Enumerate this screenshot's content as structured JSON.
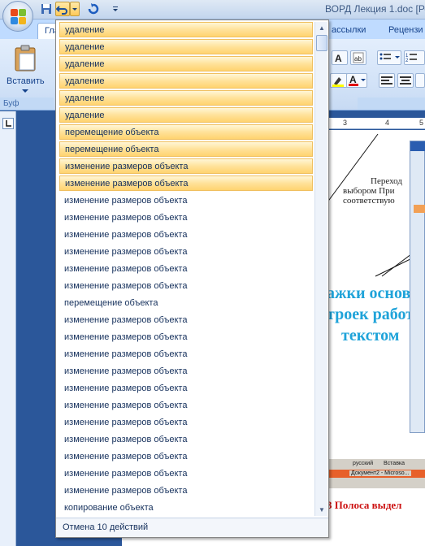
{
  "window": {
    "title": "ВОРД Лекция 1.doc [Реж"
  },
  "ribbon": {
    "tabs_visible": [
      "Гла",
      "ассылки",
      "Рецензи"
    ],
    "paste_label": "Вставить",
    "clipboard_group": "Буф"
  },
  "document": {
    "ruler_numbers": [
      "3",
      "4",
      "5"
    ],
    "text_small_1": "Переход",
    "text_small_2": "выбором При",
    "text_small_3": "соответствую",
    "text_big_1": "ажки основ",
    "text_big_2": "троек работ",
    "text_big_3": "текстом",
    "text_red": "3 Полоса выдел",
    "taskbar_lang": "русский",
    "taskbar_insert": "Вставка",
    "taskbar_doc": "Документ2 - Microso..."
  },
  "undo_dropdown": {
    "items": [
      "удаление",
      "удаление",
      "удаление",
      "удаление",
      "удаление",
      "удаление",
      "перемещение объекта",
      "перемещение объекта",
      "изменение размеров объекта",
      "изменение размеров объекта",
      "изменение размеров объекта",
      "изменение размеров объекта",
      "изменение размеров объекта",
      "изменение размеров объекта",
      "изменение размеров объекта",
      "изменение размеров объекта",
      "перемещение объекта",
      "изменение размеров объекта",
      "изменение размеров объекта",
      "изменение размеров объекта",
      "изменение размеров объекта",
      "изменение размеров объекта",
      "изменение размеров объекта",
      "изменение размеров объекта",
      "изменение размеров объекта",
      "изменение размеров объекта",
      "изменение размеров объекта",
      "изменение размеров объекта",
      "копирование объекта"
    ],
    "selected_count": 10,
    "footer": "Отмена 10 действий"
  }
}
